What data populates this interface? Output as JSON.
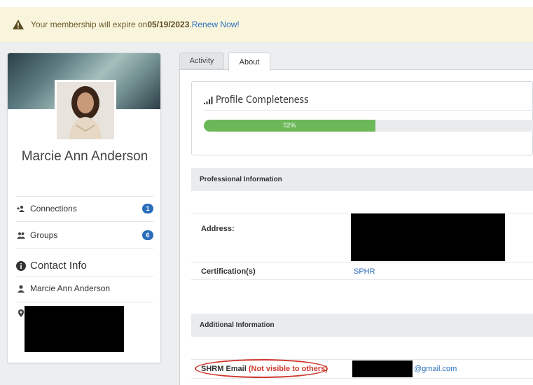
{
  "alert": {
    "prefix": "Your membership will expire on ",
    "date": "05/19/2023",
    "sep": ". ",
    "renew": "Renew Now!"
  },
  "profile": {
    "name": "Marcie Ann Anderson",
    "connections_label": "Connections",
    "connections_count": "1",
    "groups_label": "Groups",
    "groups_count": "6",
    "contact_title": "Contact Info",
    "contact_name": "Marcie Ann Anderson"
  },
  "tabs": {
    "activity": "Activity",
    "about": "About"
  },
  "completeness": {
    "title": "Profile Completeness",
    "percent_label": "52%",
    "percent": 0.52
  },
  "professional": {
    "header": "Professional Information",
    "address_label": "Address:",
    "cert_label": "Certification(s)",
    "cert_value": "SPHR"
  },
  "additional": {
    "header": "Additional Information",
    "email_label": "SHRM Email ",
    "email_note": "(Not visible to others)",
    "email_domain": "@gmail.com"
  },
  "colors": {
    "accent": "#2a6ebb",
    "progress": "#6cb859",
    "warning": "#d0382e"
  }
}
